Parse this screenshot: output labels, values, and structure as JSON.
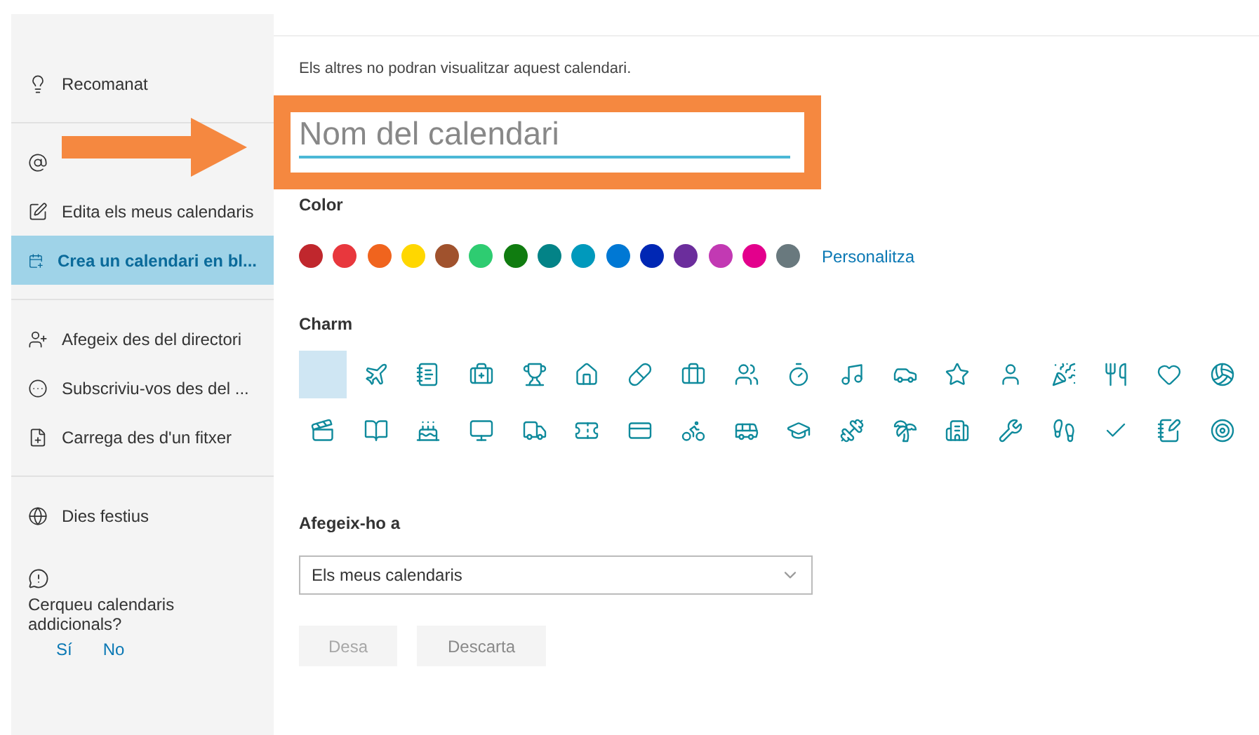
{
  "sidebar": {
    "groups": [
      {
        "items": [
          {
            "label": "Recomanat",
            "selected": false
          }
        ]
      },
      {
        "items": [
          {
            "selected": false
          },
          {
            "label": "Edita els meus calendaris",
            "selected": false
          },
          {
            "label": "Crea un calendari en bl...",
            "selected": true
          }
        ]
      },
      {
        "items": [
          {
            "label": "Afegeix des del directori",
            "selected": false
          },
          {
            "label": "Subscriviu-vos des del ...",
            "selected": false
          },
          {
            "label": "Carrega des d'un fitxer",
            "selected": false
          }
        ]
      },
      {
        "items": [
          {
            "label": "Dies festius",
            "selected": false
          }
        ]
      }
    ],
    "prompt": {
      "text": "Cerqueu calendaris addicionals?",
      "links": [
        "Sí",
        "No"
      ]
    }
  },
  "form": {
    "hint": "Els altres no podran visualitzar aquest calendari.",
    "name_field": {
      "placeholder": "Nom del calendari"
    },
    "color_label": "Color",
    "colors": [
      {
        "color": "#c0272d",
        "selected": false
      },
      {
        "color": "#e8373d",
        "selected": false
      },
      {
        "color": "#f0641e",
        "selected": false
      },
      {
        "color": "#ffd700",
        "selected": false
      },
      {
        "color": "#a0522d",
        "selected": false
      },
      {
        "color": "#2ecc71",
        "selected": false
      },
      {
        "color": "#107c10",
        "selected": false
      },
      {
        "color": "#038387",
        "selected": false
      },
      {
        "color": "#0099bc",
        "selected": false
      },
      {
        "color": "#0078d4",
        "selected": false
      },
      {
        "color": "#0027b4",
        "selected": false
      },
      {
        "color": "#6b2d9c",
        "selected": false
      },
      {
        "color": "#c239b3",
        "selected": false
      },
      {
        "color": "#e3008c",
        "selected": false
      },
      {
        "color": "#69797e",
        "selected": false
      }
    ],
    "customize_link": "Personalitza",
    "charm_label": "Charm",
    "charms": [
      {
        "selected": true
      },
      {
        "selected": false
      },
      {
        "selected": false
      },
      {
        "selected": false
      },
      {
        "selected": false
      },
      {
        "selected": false
      },
      {
        "selected": false
      },
      {
        "selected": false
      },
      {
        "selected": false
      },
      {
        "selected": false
      },
      {
        "selected": false
      },
      {
        "selected": false
      },
      {
        "selected": false
      },
      {
        "selected": false
      },
      {
        "selected": false
      },
      {
        "selected": false
      },
      {
        "selected": false
      },
      {
        "selected": false
      },
      {
        "selected": false
      },
      {
        "selected": false
      },
      {
        "selected": false
      },
      {
        "selected": false
      },
      {
        "selected": false
      },
      {
        "selected": false
      },
      {
        "selected": false
      },
      {
        "selected": false
      },
      {
        "selected": false
      },
      {
        "selected": false
      },
      {
        "selected": false
      },
      {
        "selected": false
      },
      {
        "selected": false
      },
      {
        "selected": false
      },
      {
        "selected": false
      },
      {
        "selected": false
      },
      {
        "selected": false
      },
      {
        "selected": false
      }
    ],
    "add_to_label": "Afegeix-ho a",
    "add_to_select": {
      "value": "Els meus calendaris"
    },
    "buttons": [
      {
        "label": "Desa",
        "disabled": true
      },
      {
        "label": "Descarta",
        "disabled": false
      }
    ]
  }
}
